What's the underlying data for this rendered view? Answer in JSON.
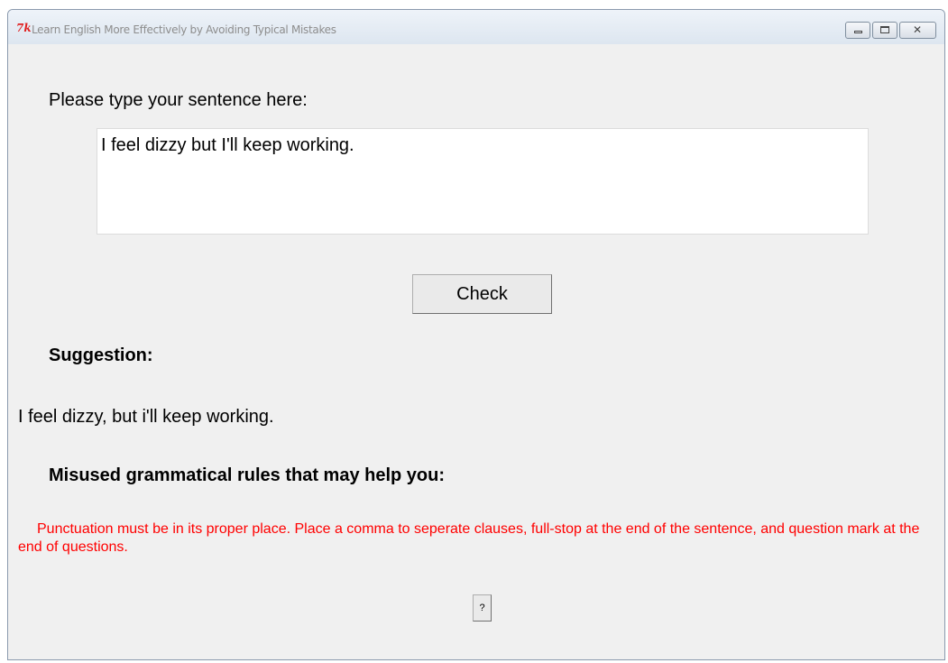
{
  "window": {
    "title": "Learn English More Effectively by Avoiding Typical Mistakes",
    "logo_text": "7k",
    "controls": [
      "minimize-icon",
      "maximize-icon",
      "close-icon"
    ]
  },
  "prompt_label": "Please type your sentence here:",
  "sentence_input": {
    "value": "I feel dizzy but I'll keep working."
  },
  "check_button": {
    "label": "Check"
  },
  "suggestion": {
    "heading": "Suggestion:",
    "text": "I feel dizzy, but i'll keep working."
  },
  "rules": {
    "heading": "Misused grammatical rules that may help you:",
    "text": "Punctuation must be in its proper place. Place a comma to seperate clauses, full-stop at the end of the sentence, and question mark at the end of questions.",
    "color": "#ff0000"
  },
  "help_button": {
    "label": "?"
  }
}
